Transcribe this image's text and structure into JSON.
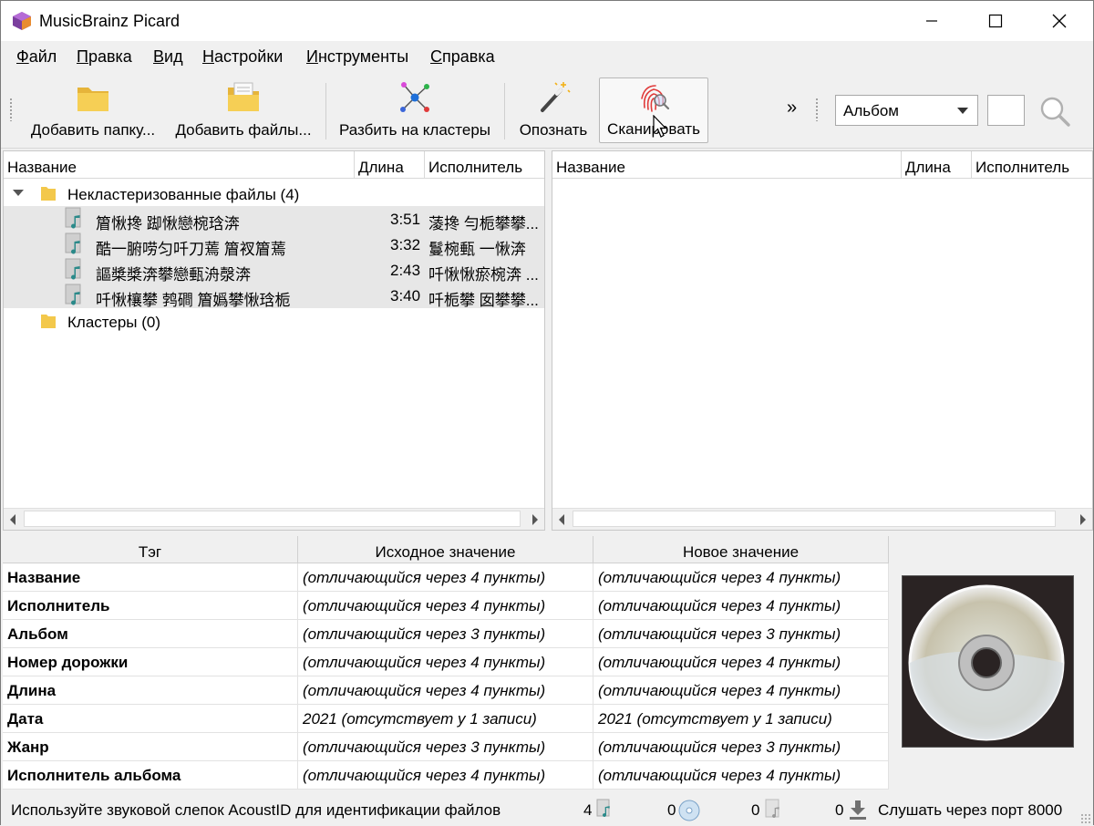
{
  "window": {
    "title": "MusicBrainz Picard"
  },
  "menu": [
    {
      "u": "Ф",
      "rest": "айл"
    },
    {
      "u": "П",
      "rest": "равка"
    },
    {
      "u": "В",
      "rest": "ид"
    },
    {
      "u": "Н",
      "rest": "астройки"
    },
    {
      "u": "И",
      "rest": "нструменты"
    },
    {
      "u": "С",
      "rest": "правка"
    }
  ],
  "toolbar": {
    "add_folder": "Добавить папку...",
    "add_files": "Добавить файлы...",
    "cluster": "Разбить на кластеры",
    "lookup": "Опознать",
    "scan": "Сканировать",
    "overflow": "»",
    "search_type": "Альбом",
    "search_value": ""
  },
  "left_pane": {
    "columns": [
      "Название",
      "Длина",
      "Исполнитель"
    ],
    "unclustered_label": "Некластеризованные файлы (4)",
    "files": [
      {
        "title": "篃愀搀 踋愀戀椀琀渀",
        "length": "3:51",
        "artist": "蓤搀 勻栀攀攀..."
      },
      {
        "title": "酷一腑唠匀吀刀蔫 篃衩篃蔫",
        "length": "3:32",
        "artist": "鬘椀甀 一愀渀"
      },
      {
        "title": "謳槳槳渀攀戀甀洀漀渀",
        "length": "2:43",
        "artist": "吀愀愀瘀椀渀 ..."
      },
      {
        "title": "吀愀欀攀 鹁磵 篃嬀攀愀琀栀",
        "length": "3:40",
        "artist": "吀栀攀 囡攀攀..."
      }
    ],
    "clusters_label": "Кластеры (0)"
  },
  "right_pane": {
    "columns": [
      "Название",
      "Длина",
      "Исполнитель"
    ]
  },
  "metadata": {
    "columns": [
      "Тэг",
      "Исходное значение",
      "Новое значение"
    ],
    "rows": [
      {
        "tag": "Название",
        "orig": "(отличающийся через 4 пункты)",
        "new": "(отличающийся через 4 пункты)"
      },
      {
        "tag": "Исполнитель",
        "orig": "(отличающийся через 4 пункты)",
        "new": "(отличающийся через 4 пункты)"
      },
      {
        "tag": "Альбом",
        "orig": "(отличающийся через 3 пункты)",
        "new": "(отличающийся через 3 пункты)"
      },
      {
        "tag": "Номер дорожки",
        "orig": "(отличающийся через 4 пункты)",
        "new": "(отличающийся через 4 пункты)"
      },
      {
        "tag": "Длина",
        "orig": "(отличающийся через 4 пункты)",
        "new": "(отличающийся через 4 пункты)"
      },
      {
        "tag": "Дата",
        "orig": "2021 (отсутствует у 1 записи)",
        "new": "2021 (отсутствует у 1 записи)"
      },
      {
        "tag": "Жанр",
        "orig": "(отличающийся через 3 пункты)",
        "new": "(отличающийся через 3 пункты)"
      },
      {
        "tag": "Исполнитель альбома",
        "orig": "(отличающийся через 4 пункты)",
        "new": "(отличающийся через 4 пункты)"
      }
    ]
  },
  "status": {
    "message": "Используйте звуковой слепок AcoustID для идентификации файлов",
    "files_count": "4",
    "albums_count": "0",
    "pending_count": "0",
    "requests_count": "0",
    "port_text": "Слушать через порт 8000"
  },
  "colors": {
    "folder": "#f3c84b",
    "note": "#2b8a8a",
    "fingerprint": "#e03a3a",
    "cluster_blue": "#1e6fd9"
  },
  "icons": [
    "app-icon",
    "minimize-icon",
    "maximize-icon",
    "close-icon",
    "folder-icon",
    "folder-files-icon",
    "cluster-icon",
    "magic-wand-icon",
    "fingerprint-icon",
    "search-icon",
    "file-music-icon",
    "cd-icon",
    "download-icon"
  ]
}
